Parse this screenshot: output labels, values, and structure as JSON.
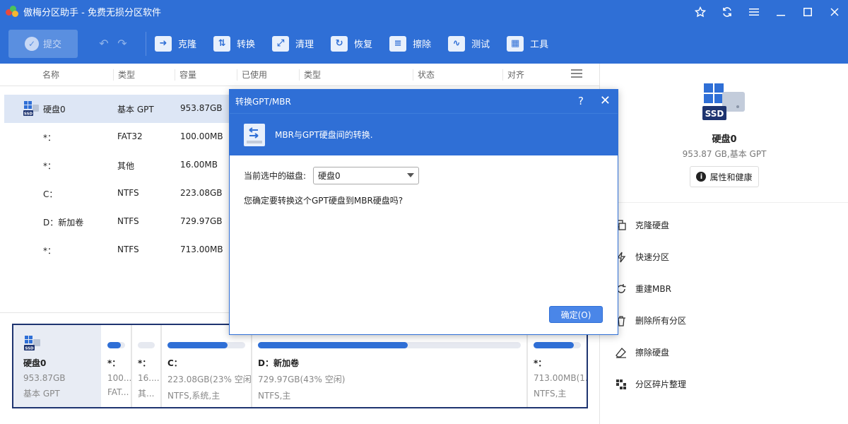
{
  "app": {
    "title": "傲梅分区助手 - 免费无损分区软件"
  },
  "toolbar": {
    "commit_label": "提交",
    "tools": [
      {
        "label": "克隆",
        "icon": "clone-icon"
      },
      {
        "label": "转换",
        "icon": "convert-icon"
      },
      {
        "label": "清理",
        "icon": "clean-icon"
      },
      {
        "label": "恢复",
        "icon": "recover-icon"
      },
      {
        "label": "擦除",
        "icon": "wipe-icon"
      },
      {
        "label": "测试",
        "icon": "test-icon"
      },
      {
        "label": "工具",
        "icon": "tools-icon"
      }
    ]
  },
  "table": {
    "headers": [
      "名称",
      "类型",
      "容量",
      "已使用",
      "类型",
      "状态",
      "对齐"
    ],
    "rows": [
      {
        "name": "硬盘0",
        "type": "基本 GPT",
        "capacity": "953.87GB"
      },
      {
        "name": "*：",
        "type": "FAT32",
        "capacity": "100.00MB"
      },
      {
        "name": "*：",
        "type": "其他",
        "capacity": "16.00MB"
      },
      {
        "name": "C：",
        "type": "NTFS",
        "capacity": "223.08GB"
      },
      {
        "name": "D：新加卷",
        "type": "NTFS",
        "capacity": "729.97GB"
      },
      {
        "name": "*：",
        "type": "NTFS",
        "capacity": "713.00MB"
      }
    ]
  },
  "diskmap": {
    "disk": {
      "badge": "SSD",
      "name": "硬盘0",
      "size": "953.87GB",
      "type": "基本 GPT"
    },
    "partitions": [
      {
        "name": "*：",
        "line1": "100...",
        "line2": "FAT...",
        "used": 0.75
      },
      {
        "name": "*：",
        "line1": "16....",
        "line2": "其...",
        "used": 0.0
      },
      {
        "name": "C：",
        "line1": "223.08GB(23% 空闲)",
        "line2": "NTFS,系统,主",
        "used": 0.77
      },
      {
        "name": "D：新加卷",
        "line1": "729.97GB(43% 空闲)",
        "line2": "NTFS,主",
        "used": 0.57
      },
      {
        "name": "*：",
        "line1": "713.00MB(1...",
        "line2": "NTFS,主",
        "used": 0.85
      }
    ]
  },
  "right_panel": {
    "disk_badge": "SSD",
    "disk_name": "硬盘0",
    "disk_info": "953.87 GB,基本 GPT",
    "properties_label": "属性和健康",
    "actions": [
      {
        "label": "克隆硬盘",
        "icon": "clone-disk-icon"
      },
      {
        "label": "快速分区",
        "icon": "quick-partition-icon"
      },
      {
        "label": "重建MBR",
        "icon": "rebuild-mbr-icon"
      },
      {
        "label": "删除所有分区",
        "icon": "delete-icon"
      },
      {
        "label": "擦除硬盘",
        "icon": "eraser-icon"
      },
      {
        "label": "分区碎片整理",
        "icon": "defrag-icon"
      }
    ]
  },
  "dialog": {
    "title": "转换GPT/MBR",
    "help": "?",
    "banner_text": "MBR与GPT硬盘间的转换.",
    "disk_label": "当前选中的磁盘:",
    "disk_value": "硬盘0",
    "question": "您确定要转换这个GPT硬盘到MBR硬盘吗?",
    "ok_label": "确定(O)"
  },
  "colors": {
    "accent": "#2f6fd6",
    "selected_row": "#dde6f5",
    "map_border": "#1e3470"
  }
}
